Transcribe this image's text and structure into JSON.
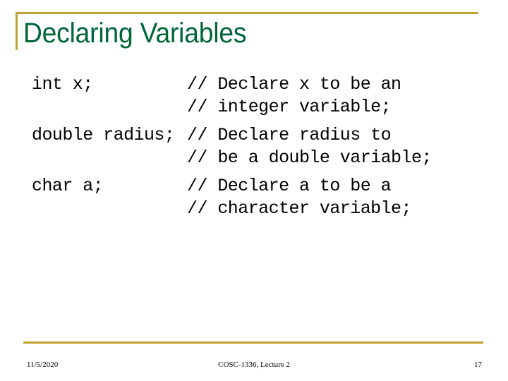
{
  "slide": {
    "title": "Declaring Variables",
    "accent_color": "#bfa22f",
    "title_color": "#006637",
    "background_color": "#ffffff",
    "code_color": "#000000"
  },
  "code_blocks": [
    {
      "declaration": "int x;",
      "comments": [
        "// Declare x to be an",
        "// integer variable;"
      ]
    },
    {
      "declaration": "double radius;",
      "comments": [
        "// Declare radius to",
        "// be a double variable;"
      ]
    },
    {
      "declaration": "char a;",
      "comments": [
        "// Declare a to be a",
        "// character variable;"
      ]
    }
  ],
  "footer": {
    "date": "11/5/2020",
    "course": "COSC-1336, Lecture 2",
    "page_number": "17"
  }
}
